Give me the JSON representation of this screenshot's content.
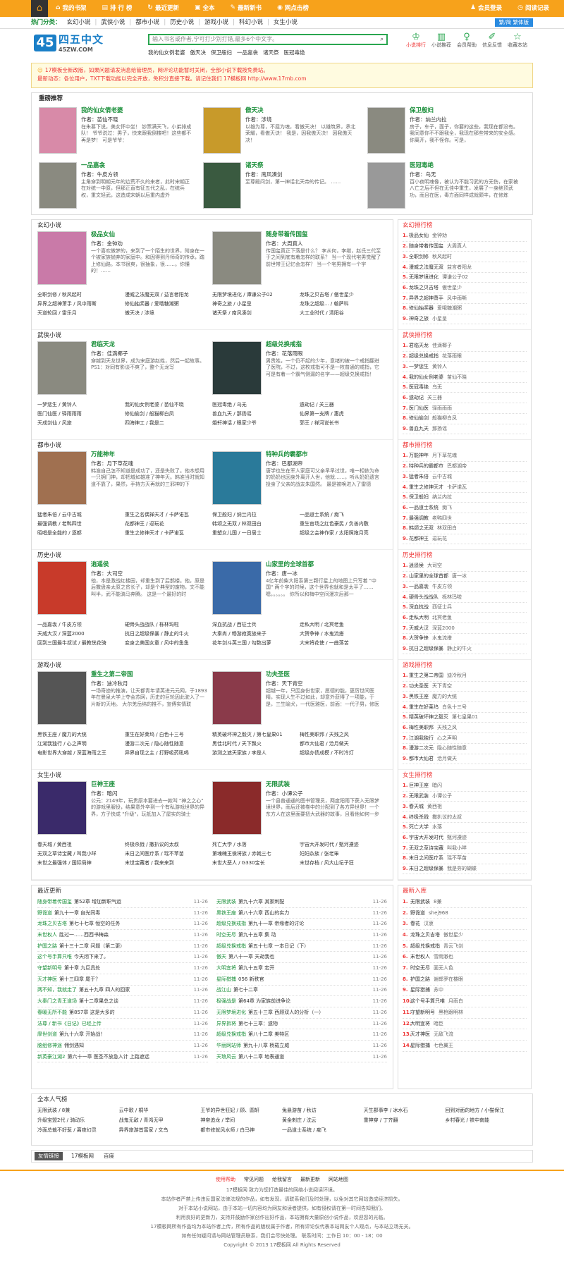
{
  "topnav": [
    {
      "icon": "⌂",
      "label": "我的书架"
    },
    {
      "icon": "▤",
      "label": "排 行 榜"
    },
    {
      "icon": "↻",
      "label": "最近更新"
    },
    {
      "icon": "▣",
      "label": "全本"
    },
    {
      "icon": "✎",
      "label": "最新新书"
    },
    {
      "icon": "◉",
      "label": "网点击榜"
    }
  ],
  "topright": [
    {
      "icon": "♟",
      "label": "会员登录"
    },
    {
      "icon": "◷",
      "label": "阅读记录"
    }
  ],
  "catbar": {
    "label": "热门分类：",
    "items": [
      "玄幻小说",
      "武侠小说",
      "都市小说",
      "历史小说",
      "游戏小说",
      "科幻小说",
      "女生小说"
    ],
    "ts": "繁/简 繁体版"
  },
  "logo": {
    "num": "45",
    "cn": "四五中文",
    "en": "45ZW.COM"
  },
  "search": {
    "placeholder": "输入书名或作者,宁可打少别打错,最多6个中文字。"
  },
  "hotkeys": [
    "我的仙女例老婆",
    "傲天决",
    "保卫般妇",
    "一品嘉衾",
    "诸天祭",
    "医冠毒绝"
  ],
  "iconnav": [
    {
      "icon": "♔",
      "label": "小说排行"
    },
    {
      "icon": "▥",
      "label": "小说推荐"
    },
    {
      "icon": "♀",
      "label": "会员帮助"
    },
    {
      "icon": "✐",
      "label": "信息反馈"
    },
    {
      "icon": "☆",
      "label": "收藏本站"
    }
  ],
  "notice": {
    "line1": "17模板全新改版，如果问题请发消息给管理员，网评论功能暂时关闭，全部小说下载按免费站。",
    "line2": "最新动态：各位用户，TXT下载功能以完全开放，免积分直接下载。请记住我们 17模板网 http://www.17mb.com"
  },
  "rec": {
    "title": "重磅推荐",
    "items": [
      {
        "title": "我的仙女倩老婆",
        "author": "作者：苗仙不晓",
        "desc": "在朱慕下说，美女怀中坐！ 钞票满天飞，小弟排成队！ 爷爷说过：男子，快来跟我倒楼吧！这些都不再是梦！ 可是爷爷：",
        "color": "#d88aa8"
      },
      {
        "title": "傲天决",
        "author": "作者：涉境",
        "desc": "以雄为尊，不屈为魂，看傲天决！ 以雄筑界，承北荣耀，看傲天诀！ 我是，因我傲天决！ 因我傲天决！",
        "color": "#c89a2a"
      },
      {
        "title": "保卫般妇",
        "author": "作者：纳兰内拉",
        "desc": "房子，车子，面子，你要的这些，我现在都没有。我同意你不不跟我全，我现在那些带来的安全感。你离开，我不怪你。可是，",
        "color": "#8a8a80"
      },
      {
        "title": "一品嘉衾",
        "author": "作者：牛皮方领",
        "desc": "主角穿到明朝元年的边荒不久的来者，此时宋朝正在对统一中原，但那正直有征五代之乱，在统兵权，重文轻武，这造成宋朝以后重内虚外",
        "color": "#8a8a80"
      },
      {
        "title": "诸天祭",
        "author": "作者：南风凑剑",
        "desc": "至尊殿问剑，第一神话北天帝的传记。 ……",
        "color": "#3a5a40"
      },
      {
        "title": "医冠毒绝",
        "author": "作者：乌无",
        "desc": "百小夜明魂像，被认为不能习武的方无伤，在家被八亡之后不但在无佳中重生，发展了一身绝顶武功，而且在医，毒方面同样成就颇丰，在修炼",
        "color": "#999"
      }
    ]
  },
  "sections": [
    {
      "title": "玄幻小说",
      "feat": [
        {
          "title": "极品女仙",
          "author": "作者：金钟劝",
          "desc": "一个喜欢做梦的，来到了一个陌生的世界，附身在一个被家族抛弃的家庭中。和因得到丹师奇的传承，踏上修仙路。本书很爽，很抽象，很……。你懂的！……",
          "color": "#c97aa8"
        },
        {
          "title": "随身带着传国玺",
          "author": "作者：大周真人",
          "desc": "传国玺真正下落是什么？ 李从何，李继，赵氏三代至于之间到底有着怎样的联系？ 当一个现代宅男觉醒了前世带王记忆会怎样？ 当一个宅男拥有一个宇",
          "color": "#8a8a80"
        }
      ],
      "links": [
        "全职剑修 / 秋风起时",
        "漫威之法魔无双 / 益言者阳龙",
        "无限梦境进化 / 谭谦公子02",
        "龙珠之贝吉塔 / 傲世星少",
        "异界之超神萧手 / 风中雨嘶",
        "修仙抽奖器 / 爱哦糖潮粥",
        "神奇之旅 / 小星呈",
        "龙珠之超级... / 翰萨科",
        "天道轮回 / 雷乐月",
        "傲天决 / 涉境",
        "诸天祭 / 南风凑剑",
        "大工业时代 / 清阳谷"
      ]
    },
    {
      "title": "武侠小说",
      "feat": [
        {
          "title": "君临天龙",
          "author": "作者：佳滴椰子",
          "desc": "穿越到天龙世界，成为宋庭游赵姓，然后一起故事。 PS1：对同有影谈不爽了，整个无龙写",
          "color": "#8a8a80"
        },
        {
          "title": "超级兑换戒指",
          "author": "作者：花落雨眼",
          "desc": "男贵姓，一个仍不起的少年，意绪的被一个戒指翻进了医院，不过，这枚戒指可不是一枚普通的戒指，它可是有着一个霸气侧漏的名字——超级兑换戒指！",
          "color": "#2a3a3a"
        }
      ],
      "links": [
        "一梦惩生 / 黄铃人",
        "我的仙女例老婆 / 苗仙不晓",
        "医冠毒绝 / 乌无",
        "遗劫记 / 关三器",
        "医门仙医 / 驿雨雨雨",
        "修仙偷剑 / 般猫柳白凤",
        "兽血九天 / 那扬谣",
        "仙界第一支牌 / 惠虎",
        "天成剑仙 / 风旅",
        "四海神工 / 我是二",
        "婚轩神话 / 眼家少爷",
        "郭王 / 禅河说长书"
      ]
    },
    {
      "title": "都市小说",
      "feat": [
        {
          "title": "万能神年",
          "author": "作者：月下草花魂",
          "desc": "韩准自己怎不知道是成功了，还是失败了。他本想用一只拥门神，却把城如雄准了神年天。韩准当时就知道不靠了，果然，手持方天再就的三邪神的下",
          "color": "#a07050"
        },
        {
          "title": "特种兵的霸都市",
          "author": "作者：巴都湖帝",
          "desc": "唐学也生在军人家庭可父亲早早过世，唯一相依为命的奶奶也因身外离开人世，他就……，听从奶奶遗言投身了父亲的战友朱国然。 最是被唤进入了雷德",
          "color": "#2a7a9a"
        }
      ],
      "links": [
        "猛者朱倍 / 云中古城",
        "重生之名偶禅天才 / 卡萨诺瓦",
        "保卫般妇 / 纳兰内拉",
        "一品道士系统 / 痴飞",
        "最强调教 / 老鸭四世",
        "花都神王 / 逗玩花",
        "韩颂之无双 / 林双田白",
        "重生官场之红色豪民 / 负善内敷",
        "昭唱是全能的 / 逐都",
        "重生之修神天才 / 卡萨诺瓦",
        "重塑女儿国 / 一日居士",
        "超级之会神作家 / 太阳照拖月亮"
      ]
    },
    {
      "title": "历史小说",
      "feat": [
        {
          "title": "逍遥侯",
          "author": "作者：大司空",
          "desc": "他，本是激战红楼园，却重生到了后鹊楼。他，原是后撒盘亲太原之贫长子，却是个典型的废物，文不能叫半，武不能骑马奔腾。 这是一个最好的时",
          "color": "#c83a2a"
        },
        {
          "title": "山家里的全球首都",
          "author": "作者：唐一冰",
          "desc": "4亿年前柴大阳系第三颗行星上的地图上只写着 \"中国\" 两个字的时候，这个世界也就和是太平了…… 嗯，。。。。。 你所以和梅中空间漫次后那一",
          "color": "#3a6aa8"
        }
      ],
      "links": [
        "一品嘉衾 / 牛皮方领",
        "硬骨头战战队 / 栎林玛啦",
        "深血抗战 / 西征士兵",
        "走私大明 / 北冥老鱼",
        "天威大汉 / 深蓝2000",
        "抗日之超级保暴 / 静止的牛火",
        "大秦尚 / 畅游寂寞旅来子",
        "大贺争锋 / 水鬼流搭",
        "回到三国最牛叔试 / 最教恍花骑",
        "变身之美国女童 / 风中的鱼鱼",
        "花年剑斗英三国 / 勾数出萝",
        "大宋将花使 / 一曲落苦"
      ]
    },
    {
      "title": "游戏小说",
      "feat": [
        {
          "title": "重生之第二帝国",
          "author": "作者：迪冷秋月",
          "desc": "一场奇迹的推演，让天都青年请英进元元网，于1893年在曼泉大学上夺会苏网，历史的巨轮因此驶入了一片新的天地。 大尔羌岳纬的推不，宣傅实情联",
          "color": "#555"
        },
        {
          "title": "功夫圣医",
          "author": "作者：天下青空",
          "desc": "超越一年，只因身份世家，愿德的能，更厉世间医精，实现人生不过如此，却意外获得了一项能，于是，三生喻犬，一代医雅医，前面：一代子男，修医",
          "color": "#8a3a4a"
        }
      ],
      "links": [
        "黑铁王座 / 魔力的大统",
        "重生在好莱坞 / 白色十三号",
        "精英破坏神之毅灭 / 第七皇果01",
        "梅性美职邦 / 天残之风",
        "江湖我独行 / 心之声明",
        "漫游二次元 / 隐心随性随意",
        "黑佳北时代 / 天下飘火",
        "都市大仙君 / 沧月做天",
        "电影世界大穿越 / 深蓝海雨之王",
        "异界自现之主 / 打野吸药吼喝",
        "游测之遮天家族 / 李是人",
        "超级办债成模 / 不时冷灯"
      ]
    },
    {
      "title": "女生小说",
      "feat": [
        {
          "title": "巨神王座",
          "author": "作者：暗闪",
          "desc": "公元：2149年，玩贵原本要进去一款叫 \"神之之心\" 的游戏里服役，结果意外卒到一个有私游戏世界的异界，方子快成 \"升级\"，玩抵加入了屋实的骑士",
          "color": "#3a2a6a"
        },
        {
          "title": "无限武装",
          "author": "作者：小谭公子",
          "desc": "一个县普通通的图书管理员，两度阳雨下获入无限梦境世界，而后还被卷中的分配到了各方异世界！一个东方人在这里面要扭大武器的故事，且看他如何一步",
          "color": "#8a2a2a"
        }
      ],
      "links": [
        "春天城 / 黄西祖",
        "终极杀戮 / 撒扒议的太叔",
        "死亡大学 / 水落",
        "宇宙大开发时代 / 甄河遵迹",
        "无双之草诗宝藏 / 叫我小咩",
        "末日之间医疗系 / 瑶不苹苗",
        "第魂魄王侯将族 / 赤戟三七",
        "妇妇杂族 / 张老笨",
        "末世之最强体 / 国际局神",
        "末世宝藏者 / 我来来到",
        "末世大恶人 / G330宝长",
        "末世存档 / 风大山坛子狂"
      ]
    }
  ],
  "ranks": [
    {
      "title": "玄幻排行榜",
      "items": [
        [
          "极品女仙",
          "金钟劝"
        ],
        [
          "随身带着传国玺",
          "大周真人"
        ],
        [
          "全职剑修",
          "秋风起时"
        ],
        [
          "漫威之法魔无双",
          "益言者阳龙"
        ],
        [
          "无限梦境进化",
          "谭谦公子02"
        ],
        [
          "龙珠之贝吉塔",
          "傲世星少"
        ],
        [
          "异界之超神萧手",
          "风中雨嘶"
        ],
        [
          "修仙抽奖器",
          "爱哦糖潮粥"
        ],
        [
          "神奇之旅",
          "小星呈"
        ]
      ]
    },
    {
      "title": "武侠排行榜",
      "items": [
        [
          "君临天龙",
          "佳滴椰子"
        ],
        [
          "超级兑换戒指",
          "花落雨眼"
        ],
        [
          "一梦惩生",
          "黄铃人"
        ],
        [
          "我的仙女例老婆",
          "苗仙不晓"
        ],
        [
          "医冠毒绝",
          "乌无"
        ],
        [
          "遗劫记",
          "关三器"
        ],
        [
          "医门仙医",
          "驿雨雨雨"
        ],
        [
          "修仙偷剑",
          "般猫柳白凤"
        ],
        [
          "兽血九天",
          "那扬谣"
        ]
      ]
    },
    {
      "title": "都市排行榜",
      "items": [
        [
          "万能神年",
          "月下草花魂"
        ],
        [
          "特种兵的霸都市",
          "巴都湖帝"
        ],
        [
          "猛者朱倍",
          "云中古城"
        ],
        [
          "重生之修神天才",
          "卡萨诺瓦"
        ],
        [
          "保卫般妇",
          "纳兰内拉"
        ],
        [
          "一品道士系统",
          "痴飞"
        ],
        [
          "最强调教",
          "老鸭四世"
        ],
        [
          "韩颂之无双",
          "林双田白"
        ],
        [
          "花都神王",
          "逗玩花"
        ]
      ]
    },
    {
      "title": "历史排行榜",
      "items": [
        [
          "逍遥侯",
          "大司空"
        ],
        [
          "山家里的全球首都",
          "唐一冰"
        ],
        [
          "一品嘉衾",
          "牛皮方领"
        ],
        [
          "硬骨头战战队",
          "栎林玛啦"
        ],
        [
          "深血抗战",
          "西征士兵"
        ],
        [
          "走私大明",
          "北冥老鱼"
        ],
        [
          "天威大汉",
          "深蓝2000"
        ],
        [
          "大贺争锋",
          "水鬼流搭"
        ],
        [
          "抗日之超级保暴",
          "静止的牛火"
        ]
      ]
    },
    {
      "title": "游戏排行榜",
      "items": [
        [
          "重生之第二帝国",
          "迪冷秋月"
        ],
        [
          "功夫圣医",
          "天下青空"
        ],
        [
          "黑铁王座",
          "魔力的大统"
        ],
        [
          "重生在好莱坞",
          "白色十三号"
        ],
        [
          "精英破坏神之毅灭",
          "第七皇果01"
        ],
        [
          "梅性美职邦",
          "天残之风"
        ],
        [
          "江湖我独行",
          "心之声明"
        ],
        [
          "漫游二次元",
          "隐心随性随意"
        ],
        [
          "都市大仙君",
          "沧月做天"
        ]
      ]
    },
    {
      "title": "女生排行榜",
      "items": [
        [
          "巨神王座",
          "暗闪"
        ],
        [
          "无限武装",
          "小谭公子"
        ],
        [
          "春天城",
          "黄西祖"
        ],
        [
          "终极杀戮",
          "撒扒议的太叔"
        ],
        [
          "死亡大学",
          "水落"
        ],
        [
          "宇宙大开发时代",
          "甄河遵迹"
        ],
        [
          "无双之草诗宝藏",
          "叫我小咩"
        ],
        [
          "末日之间医疗系",
          "瑶不苹苗"
        ],
        [
          "末日之超级保暴",
          "我是夯的蝴蝶"
        ]
      ]
    }
  ],
  "updates": {
    "title": "最近更新",
    "rows": [
      [
        "随身带着传国玺",
        "第52章 增加新职气运",
        "11-26"
      ],
      [
        "无限武装",
        "第九十六章 其家刺配",
        "11-26"
      ],
      [
        "野诡道",
        "第九十一章 自光同毒",
        "11-26"
      ],
      [
        "黑铁王座",
        "第八十六章 西山的实力",
        "11-26"
      ],
      [
        "龙珠之贝吉塔",
        "第七十七章 恒空的任务",
        "11-26"
      ],
      [
        "超级兑换戒指",
        "第九十一章 帝缘者的讨论",
        "11-26"
      ],
      [
        "末世权人",
        "胜过一……西西书梅森",
        "11-26"
      ],
      [
        "时空无尽",
        "第九十五章 集 动",
        "11-26"
      ],
      [
        "护国之路",
        "第十三十二章 问题（第二更）",
        "11-26"
      ],
      [
        "超级兑换戒指",
        "第五十七章 一本日记（下）",
        "11-26"
      ],
      [
        "这个号手算只唯",
        "今天闭下来了。",
        "11-26"
      ],
      [
        "傲天",
        "第八十一章 天劫我也",
        "11-26"
      ],
      [
        "守望新明号",
        "第十章 九巨具处",
        "11-26"
      ],
      [
        "大明宜将",
        "第九十五章 宏开",
        "11-26"
      ],
      [
        "天才神医",
        "第十三四章 尾于？",
        "11-26"
      ],
      [
        "星际猎捕",
        "056 新秩官",
        "11-26"
      ],
      [
        "两不知，我就走了",
        "第五十九章 四人的回家",
        "11-26"
      ],
      [
        "战江山",
        "第七十二章",
        "11-26"
      ],
      [
        "大秦门之青王道场",
        "第十二章果总之谈",
        "11-26"
      ],
      [
        "极强战是",
        "第64章 为家族前进争论",
        "11-26"
      ],
      [
        "春暖无所不能",
        "第857章 这是大多的",
        "11-26"
      ],
      [
        "无限梦境进化",
        "第五十三章 西顾双人的分析（一）",
        "11-26"
      ],
      [
        "法尊 / 新书《日记》已经上传",
        "",
        "11-26"
      ],
      [
        "异界拆将",
        "第七十三章：遗物",
        "11-26"
      ],
      [
        "摩世剑道",
        "第九十六章 开始战！",
        "11-26"
      ],
      [
        "超级兑换戒指",
        "第八十二章 美特区",
        "11-26"
      ],
      [
        "脑组修神途",
        "佣剑遇知",
        "11-26"
      ],
      [
        "华丽网站师",
        "第九十八章 杨载立威",
        "11-26"
      ],
      [
        "新英豪江湖2",
        "第六十一章 医圣不放急入计 上路遮远",
        "11-26"
      ],
      [
        "天琅风云",
        "第八十二章 地表通道",
        "11-26"
      ]
    ]
  },
  "newbooks": {
    "title": "最新入库",
    "items": [
      [
        "无限武装",
        "8兼"
      ],
      [
        "野诡道",
        "shej968"
      ],
      [
        "春花",
        "汉衷"
      ],
      [
        "龙珠之贝吉塔",
        "傲世星少"
      ],
      [
        "超级兑换戒指",
        "青云飞剑"
      ],
      [
        "末世权人",
        "雪雨澈也"
      ],
      [
        "时空无尽",
        "面无人色"
      ],
      [
        "护国之路",
        "谢郎罗在楼眼"
      ],
      [
        "星际猎捕",
        "苏中"
      ],
      [
        "这个号手算只唯",
        "月雨白"
      ],
      [
        "守望新明号",
        "黑枪跟明林"
      ],
      [
        "大明宜将",
        "暗臣"
      ],
      [
        "天才神医",
        "无敌飞流"
      ],
      [
        "星际猎捕",
        "七色翼王"
      ]
    ]
  },
  "popular": {
    "title": "全本人气榜",
    "items": [
      "无限武装 / 8兼",
      "云中歌 / 桐华",
      "王爷的异世狂妃 / 顾、圆轩",
      "兔悬游苗 / 秋访",
      "天生郡事李 / 冰水石",
      "回到对面的地方 / 小猫保江",
      "升级宝盟2代 / 骑动乐",
      "战鬼无敌 / 青鸿无甲",
      "神帝追龙 / 举间",
      "黄金刺庄 / 沈云",
      "重神穿 / 丁齐翻",
      "乡村春光 / 铁中南能",
      "冷面总裁不好惹 / 离夜幻灵",
      "异界旅游首富家 / 文鸟",
      "都市修就风水师 / 白马神",
      "一品道士系统 / 痴飞"
    ]
  },
  "friendlinks": {
    "label": "友情链接",
    "items": [
      "17模板网",
      "百度"
    ]
  },
  "footer": {
    "nav": [
      "使用帮助",
      "常见问题",
      "给我留言",
      "最新更新",
      "网站地图"
    ],
    "lines": [
      "17模板网 致力为您打造最佳的网络小说阅读环境。",
      "本站作者严禁上传违反国家法律法规的作品，如有发现，请联系我们及时处理，以免对其它网站造成经济损失。",
      "对于本站小说网站，由于本站一切内容均为网友和读者提供，如有侵权请在第一时间告知我们。",
      "利用良好的更新力，支持并鼓励作家创作出好作品，本站拥有大量原创小说作品，欢迎您的光临。",
      "17模板网所有作品均为本站作者上传，所有作品的版权属于作者，所有评论仅代表本站网友个人观点，与本站立场无关。",
      "如有任何疑问请与网站管理员联系，我们会尽快处理。 联系时间：工作日 10：00 - 18：00",
      "Copyright © 2013 17模板网 All Rights Reserved"
    ]
  }
}
